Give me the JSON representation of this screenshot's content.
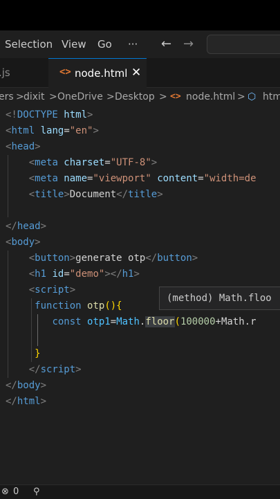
{
  "menu": {
    "selection": "Selection",
    "view": "View",
    "go": "Go",
    "more": "···",
    "back_icon": "←",
    "forward_icon": "→"
  },
  "tabs": {
    "inactive_label": ".js",
    "active_icon": "<>",
    "active_label": "node.html",
    "close_icon": "✕"
  },
  "breadcrumb": {
    "s1": "ers",
    "sep": ">",
    "s2": "dixit",
    "s3": "OneDrive",
    "s4": "Desktop",
    "file_icon": "<>",
    "s5": "node.html",
    "sym_icon": "⬡",
    "s6": "htm"
  },
  "code": {
    "l1": {
      "open": "<!",
      "tag": "DOCTYPE",
      "attr": " html",
      "close": ">"
    },
    "l2": {
      "open": "<",
      "tag": "html",
      "attr": " lang",
      "eq": "=",
      "val": "\"en\"",
      "close": ">"
    },
    "l3": {
      "open": "<",
      "tag": "head",
      "close": ">"
    },
    "l4": {
      "indent": "    ",
      "open": "<",
      "tag": "meta",
      "attr": " charset",
      "eq": "=",
      "val": "\"UTF-8\"",
      "close": ">"
    },
    "l5": {
      "indent": "    ",
      "open": "<",
      "tag": "meta",
      "attr": " name",
      "eq": "=",
      "val": "\"viewport\"",
      "attr2": " content",
      "eq2": "=",
      "val2": "\"width=de"
    },
    "l6": {
      "indent": "    ",
      "open": "<",
      "tag": "title",
      "close": ">",
      "text": "Document",
      "open2": "</",
      "tag2": "title",
      "close2": ">"
    },
    "l8": {
      "open": "</",
      "tag": "head",
      "close": ">"
    },
    "l9": {
      "open": "<",
      "tag": "body",
      "close": ">"
    },
    "l10": {
      "indent": "    ",
      "open": "<",
      "tag": "button",
      "close": ">",
      "text": "generate otp",
      "open2": "</",
      "tag2": "button",
      "close2": ">"
    },
    "l11": {
      "indent": "    ",
      "open": "<",
      "tag": "h1",
      "attr": " id",
      "eq": "=",
      "val": "\"demo\"",
      "close": ">",
      "open2": "</",
      "tag2": "h1",
      "close2": ">"
    },
    "l12": {
      "indent": "    ",
      "open": "<",
      "tag": "script",
      "close": ">"
    },
    "l13": {
      "indent": "     ",
      "kw": "function",
      "fn": " otp",
      "paren": "()",
      "brace": "{"
    },
    "l14": {
      "indent": "        ",
      "kw": "const",
      "var": " otp1",
      "eq": "=",
      "obj": "Math",
      "dot": ".",
      "fn": "floor",
      "paren": "(",
      "num": "100000",
      "rest": "+Math.r"
    },
    "l16": {
      "indent": "     ",
      "brace": "}"
    },
    "l17": {
      "indent": "    ",
      "open": "</",
      "tag": "script",
      "close": ">"
    },
    "l18": {
      "open": "</",
      "tag": "body",
      "close": ">"
    },
    "l19": {
      "open": "</",
      "tag": "html",
      "close": ">"
    }
  },
  "hover": {
    "text": "(method) Math.floo"
  },
  "status": {
    "errors_icon": "⊗",
    "errors": "0",
    "ports_icon": "⚲"
  }
}
